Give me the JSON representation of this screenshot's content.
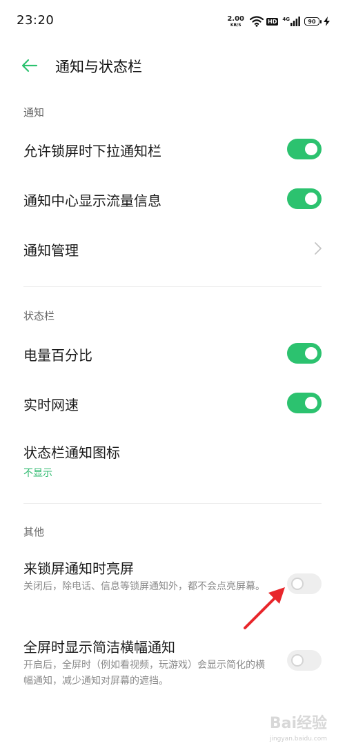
{
  "status_bar": {
    "time": "23:20",
    "net_speed_value": "2.00",
    "net_speed_unit": "KB/S",
    "hd_label": "HD",
    "signal_label": "4G",
    "battery": "90"
  },
  "header": {
    "back_icon": "arrow-left-icon",
    "title": "通知与状态栏"
  },
  "sections": {
    "notification": {
      "label": "通知",
      "items": [
        {
          "title": "允许锁屏时下拉通知栏",
          "toggle": true
        },
        {
          "title": "通知中心显示流量信息",
          "toggle": true
        },
        {
          "title": "通知管理",
          "chevron": true
        }
      ]
    },
    "status_bar": {
      "label": "状态栏",
      "items": [
        {
          "title": "电量百分比",
          "toggle": true
        },
        {
          "title": "实时网速",
          "toggle": true
        },
        {
          "title": "状态栏通知图标",
          "value": "不显示"
        }
      ]
    },
    "other": {
      "label": "其他",
      "items": [
        {
          "title": "来锁屏通知时亮屏",
          "subtitle": "关闭后，除电话、信息等锁屏通知外，都不会点亮屏幕。",
          "toggle": false
        },
        {
          "title": "全屏时显示简洁横幅通知",
          "subtitle": "开启后，全屏时（例如看视频，玩游戏）会显示简化的横幅通知，减少通知对屏幕的遮挡。",
          "toggle": false
        }
      ]
    }
  },
  "colors": {
    "accent": "#2cc26f",
    "value_text": "#2fba6f",
    "annotation_arrow": "#e8262b"
  },
  "watermark": {
    "text": "Bai经验",
    "sub": "jingyan.baidu.com"
  }
}
